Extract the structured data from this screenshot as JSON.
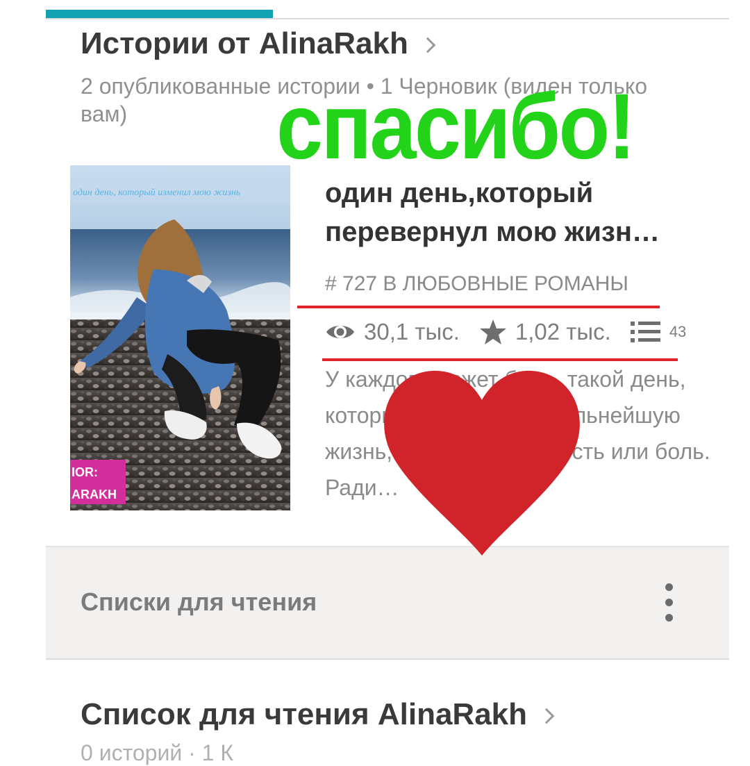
{
  "section": {
    "title": "Истории от AlinaRakh",
    "subtitle": "2 опубликованные истории • 1 Черновик (виден только вам)"
  },
  "overlay": {
    "thanks_text": "спасибо!",
    "heart_color": "#d1242a",
    "thanks_color": "#22d319",
    "underline_color": "#e0242b"
  },
  "story": {
    "cover_caption": "один день, который изменил мою жизнь",
    "cover_author": [
      "IOR:",
      "ARAKH"
    ],
    "title": "один день,который перевернул мою жизн…",
    "rank": "# 727 В ЛЮБОВНЫЕ РОМАНЫ",
    "reads": "30,1 тыс.",
    "votes": "1,02 тыс.",
    "parts": "43",
    "description": "У каждого может быть, такой день, который повлияет на дальнейшую жизнь, на счастье, радость или боль. Ради…",
    "icons": {
      "reads": "eye-icon",
      "votes": "star-icon",
      "parts": "list-icon"
    }
  },
  "lists": {
    "label": "Списки для чтения",
    "menu_icon": "more-vert-icon"
  },
  "reading_list": {
    "title": "Список для чтения AlinaRakh",
    "subtitle_cut": "0 историй · 1 К"
  },
  "colors": {
    "accent": "#12a3b3",
    "title_text": "#3a3a3a",
    "muted_text": "#8a8a8a"
  }
}
